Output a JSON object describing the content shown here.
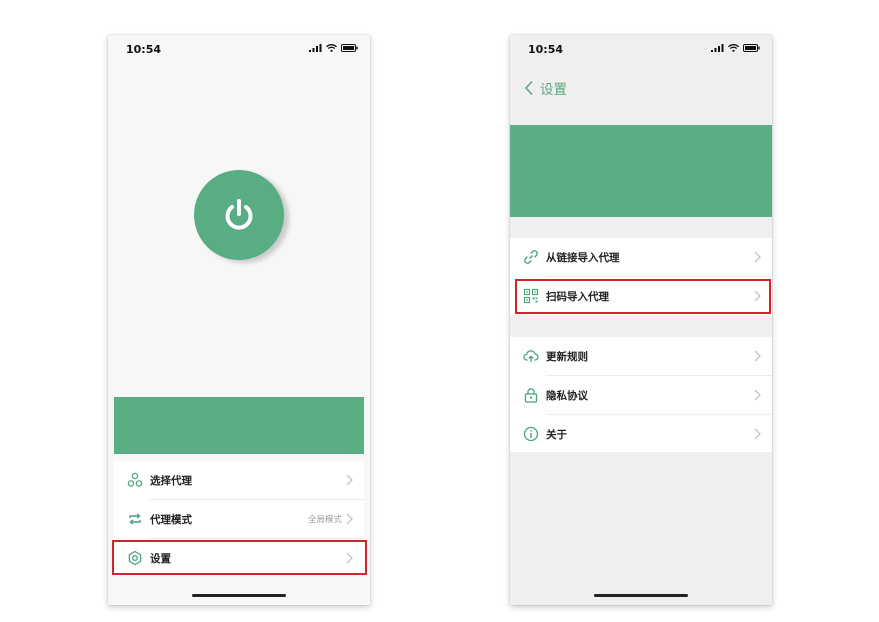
{
  "status_bar": {
    "time": "10:54"
  },
  "main_screen": {
    "menu": [
      {
        "label": "选择代理",
        "icon": "proxy-nodes-icon",
        "value": ""
      },
      {
        "label": "代理模式",
        "icon": "repeat-icon",
        "value": "全局模式"
      },
      {
        "label": "设置",
        "icon": "settings-icon",
        "value": ""
      }
    ]
  },
  "settings_screen": {
    "title": "设置",
    "group1": [
      {
        "label": "从链接导入代理",
        "icon": "link-icon"
      },
      {
        "label": "扫码导入代理",
        "icon": "qr-code-icon"
      }
    ],
    "group2": [
      {
        "label": "更新规则",
        "icon": "cloud-upload-icon"
      },
      {
        "label": "隐私协议",
        "icon": "lock-icon"
      },
      {
        "label": "关于",
        "icon": "info-icon"
      }
    ]
  },
  "colors": {
    "accent": "#58ad83",
    "highlight": "#d0242c",
    "background": "#f3f3f3"
  }
}
